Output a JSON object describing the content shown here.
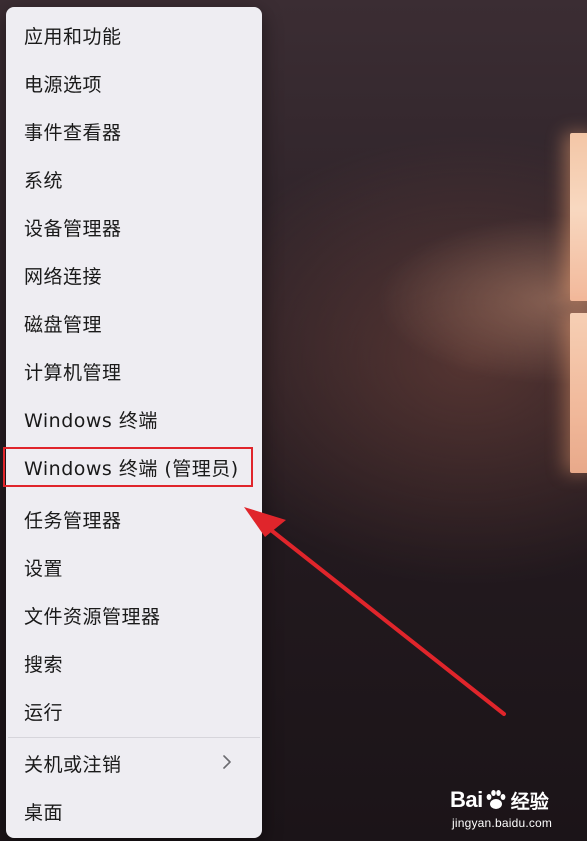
{
  "menu": {
    "items": [
      {
        "label": "应用和功能"
      },
      {
        "label": "电源选项"
      },
      {
        "label": "事件查看器"
      },
      {
        "label": "系统"
      },
      {
        "label": "设备管理器"
      },
      {
        "label": "网络连接"
      },
      {
        "label": "磁盘管理"
      },
      {
        "label": "计算机管理"
      },
      {
        "label": "Windows 终端"
      },
      {
        "label": "Windows 终端 (管理员)"
      },
      {
        "label": "任务管理器"
      },
      {
        "label": "设置"
      },
      {
        "label": "文件资源管理器"
      },
      {
        "label": "搜索"
      },
      {
        "label": "运行"
      },
      {
        "label": "关机或注销"
      },
      {
        "label": "桌面"
      }
    ],
    "highlighted_item": "Windows 终端 (管理员)"
  },
  "annotation": {
    "highlight_color": "#e0252b",
    "arrow_color": "#e0252b"
  },
  "watermark": {
    "brand_left": "Bai",
    "brand_right": "经验",
    "url": "jingyan.baidu.com"
  }
}
